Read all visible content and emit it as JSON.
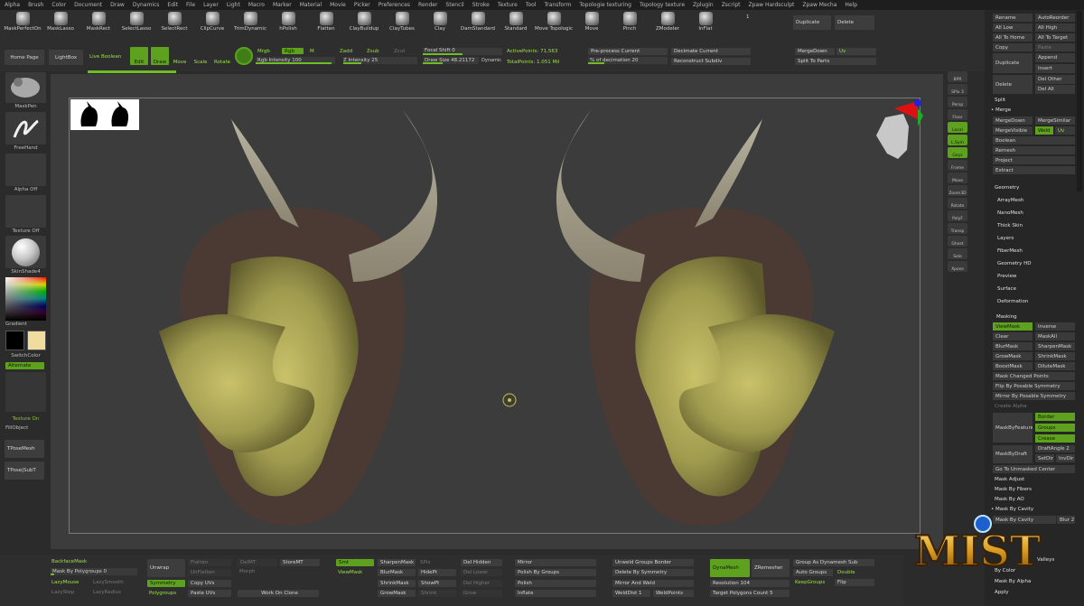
{
  "menu": [
    "Alpha",
    "Brush",
    "Color",
    "Document",
    "Draw",
    "Dynamics",
    "Edit",
    "File",
    "Layer",
    "Light",
    "Macro",
    "Marker",
    "Material",
    "Movie",
    "Picker",
    "Preferences",
    "Render",
    "Stencil",
    "Stroke",
    "Texture",
    "Tool",
    "Transform",
    "Topologie texturing",
    "Topology texture",
    "Zplugin",
    "Zscript",
    "Zpaw Hardsculpt",
    "Zpaw Mecha",
    "Help"
  ],
  "brushes": [
    "MaskPerfectOn",
    "MaskLasso",
    "MaskRect",
    "SelectLasso",
    "SelectRect",
    "ClipCurve",
    "TrimDynamic",
    "hPolish",
    "Flatten",
    "ClayBuildup",
    "ClayTubes",
    "Clay",
    "DamStandard",
    "Standard",
    "Move Topologic",
    "Move",
    "Pinch",
    "ZModeler",
    "InFlat"
  ],
  "brush_count": "1",
  "top_right": {
    "duplicate": "Duplicate",
    "delete": "Delete"
  },
  "top": {
    "home": "Home Page",
    "lightbox": "LightBox",
    "live_boolean": "Live Boolean",
    "edit": "Edit",
    "draw": "Draw",
    "move": "Move",
    "scale": "Scale",
    "rotate": "Rotate",
    "mrgb": "Mrgb",
    "rgb": "Rgb",
    "m": "M",
    "rgb_intensity": "Rgb Intensity 100",
    "zadd": "Zadd",
    "zsub": "Zsub",
    "zcut": "Zcut",
    "z_intensity": "Z Intensity 25",
    "focal_shift": "Focal Shift 0",
    "draw_size": "Draw Size 48.21172",
    "dynamic": "Dynamic",
    "active_points": "ActivePoints: 71,563",
    "total_points": "TotalPoints: 1.051 Mil",
    "preprocess": "Pre-process Current",
    "pct_decimation": "% of decimation 20",
    "decimate": "Decimate Current",
    "reconstruct": "Reconstruct Subdiv",
    "merge_down": "MergeDown",
    "uv": "Uv",
    "split_parts": "Split To Parts"
  },
  "left": {
    "maskpen": "MaskPen",
    "freehand": "FreeHand",
    "alpha_off": "Alpha Off",
    "texture_off": "Texture Off",
    "skinshade": "SkinShade4",
    "gradient": "Gradient",
    "switchcolor": "SwitchColor",
    "alternate": "Alternate",
    "texture_on": "Texture On",
    "fillobject": "FillObject",
    "tposemesh": "TPoseMesh",
    "tpose_subt": "TPose|SubT",
    "main_color": "#000000",
    "secondary_color": "#f1dca0"
  },
  "rightshelf": [
    "BPR",
    "SPix 3",
    "Persp",
    "Floor",
    "Local",
    "L.Sym",
    "Gxyz",
    "Frame",
    "Move",
    "Zoom3D",
    "Rotate",
    "PolyF",
    "Transp",
    "Ghost",
    "Solo",
    "Xpose"
  ],
  "rightpanel": {
    "rename": "Rename",
    "autoreorder": "AutoReorder",
    "all_low": "All Low",
    "all_high": "All High",
    "all_home": "All To Home",
    "all_target": "All To Target",
    "copy": "Copy",
    "paste": "Paste",
    "duplicate": "Duplicate",
    "append": "Append",
    "insert": "Insert",
    "delete": "Delete",
    "del_other": "Del Other",
    "del_all": "Del All",
    "split": "Split",
    "merge": "Merge",
    "merge_down": "MergeDown",
    "merge_similar": "MergeSimilar",
    "merge_visible": "MergeVisible",
    "weld": "Weld",
    "uv": "Uv",
    "boolean": "Boolean",
    "remesh": "Remesh",
    "project": "Project",
    "extract": "Extract",
    "sections": [
      "Geometry",
      "ArrayMesh",
      "NanoMesh",
      "Thick Skin",
      "Layers",
      "FiberMesh",
      "Geometry HD",
      "Preview",
      "Surface",
      "Deformation"
    ],
    "masking": "Masking",
    "viewmask": "ViewMask",
    "inverse": "Inverse",
    "clear": "Clear",
    "maskall": "MaskAll",
    "blurmask": "BlurMask",
    "sharpenmask": "SharpenMask",
    "growmask": "GrowMask",
    "shrinkmask": "ShrinkMask",
    "boostmask": "BoostMask",
    "dilutemask": "DiluteMask",
    "mask_changed": "Mask Changed Points",
    "flip_sym": "Flip By Posable Symmetry",
    "mirror_sym": "Mirror By Posable Symmetry",
    "create_alpha": "Create Alpha",
    "mask_by_feature": "MaskByFeature",
    "border": "Border",
    "groups": "Groups",
    "crease": "Crease",
    "mask_by_draft": "MaskByDraft",
    "draft_angle": "DraftAngle 2",
    "setdir": "SetDir",
    "invdir": "InvDir",
    "goto_center": "Go To Unmasked Center",
    "mask_adjust": "Mask Adjust",
    "mask_fibers": "Mask By Fibers",
    "mask_ao": "Mask By AO",
    "mask_cavity_hdr": "Mask By Cavity",
    "mask_by_cavity": "Mask By Cavity",
    "blur": "Blur 2",
    "valleys": "Valleys",
    "by_color": "By Color",
    "mask_alpha": "Mask By Alpha",
    "apply": "Apply"
  },
  "bottom": {
    "backface": "BackfaceMask",
    "mask_polygroups": "Mask By Polygroups 0",
    "lazymouse": "LazyMouse",
    "lazysmooth": "LazySmooth",
    "lazystep": "LazyStep",
    "lazyradius": "LazyRadius",
    "unwrap": "Unwrap",
    "flatten": "Flatten",
    "unflatten": "UnFlatten",
    "symmetry": "Symmetry",
    "copy_uvs": "Copy UVs",
    "polygroups": "Polygroups",
    "paste_uvs": "Paste UVs",
    "delmt": "DelMT",
    "storemt": "StoreMT",
    "morph": "Morph",
    "work_clone": "Work On Clone",
    "smt": "Smt",
    "viewmask": "ViewMask",
    "sharpenmask": "SharpenMask",
    "blurmask": "BlurMask",
    "shrinkmask": "ShrinkMask",
    "growmask": "GrowMask",
    "spix": "SPix",
    "hidept": "HidePt",
    "showpt": "ShowPt",
    "shrink": "Shrink",
    "del_hidden": "Del Hidden",
    "del_lower": "Del Lower",
    "del_higher": "Del Higher",
    "grow": "Grow",
    "mirror": "Mirror",
    "polish_groups": "Polish By Groups",
    "polish": "Polish",
    "inflate": "Inflate",
    "unweld_groups": "Unweld Groups Border",
    "delete_sym": "Delete By Symmetry",
    "mirror_weld": "Mirror And Weld",
    "welddist": "WeldDist 1",
    "weldpoints": "WeldPoints",
    "dynamesh": "DynaMesh",
    "zremesher": "ZRemesher",
    "resolution": "Resolution 104",
    "target_polys": "Target Polygons Count 5",
    "group_dynamesh": "Group As Dynamesh Sub",
    "auto_groups": "Auto Groups",
    "double": "Double",
    "keepgroups": "KeepGroups",
    "flip": "Flip"
  },
  "logo": "MIST",
  "colors": {
    "accent": "#5ea11f",
    "bg": "#2b2b2b",
    "viewport": "#3c3c3c"
  }
}
